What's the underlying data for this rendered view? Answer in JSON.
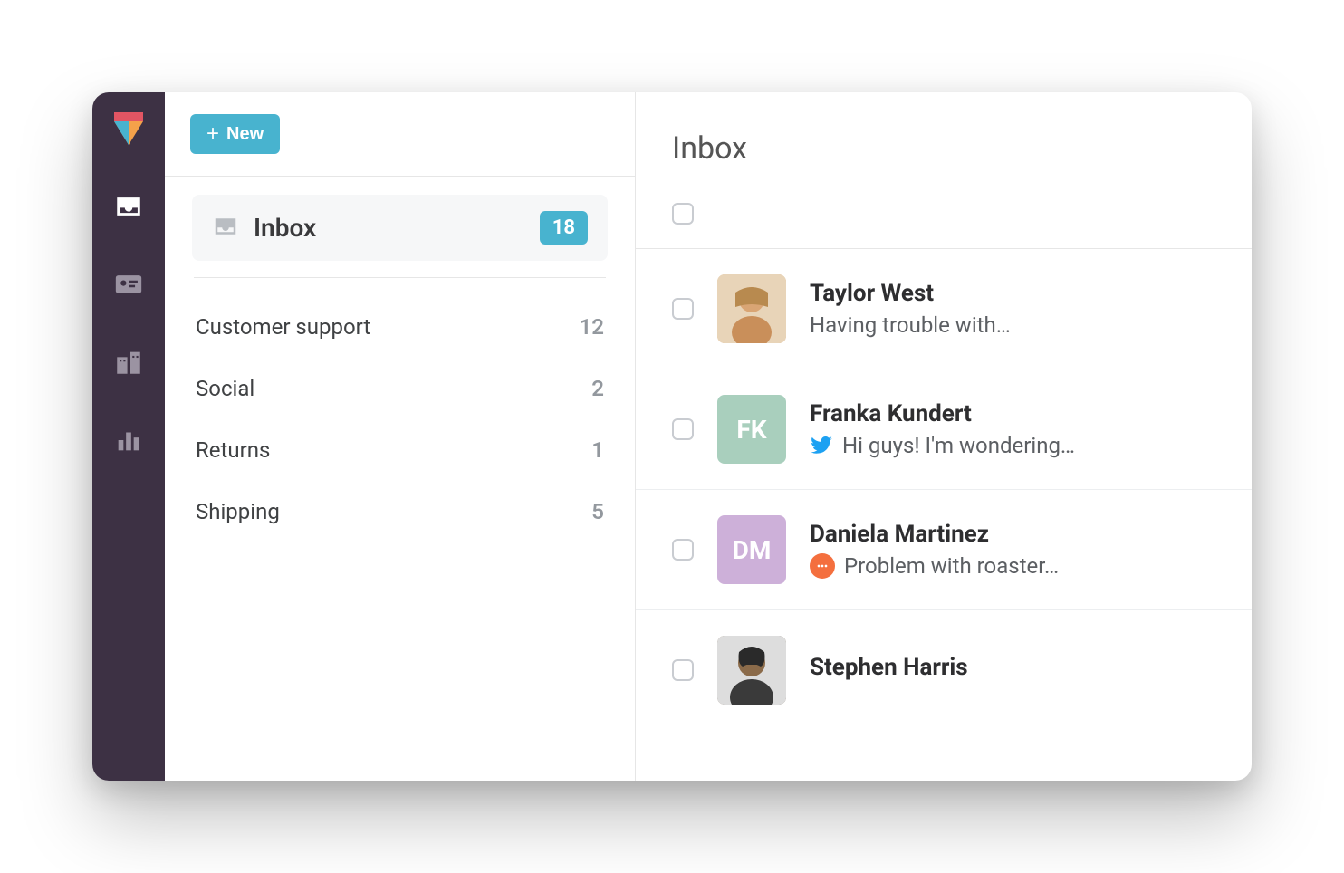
{
  "header": {
    "new_button": "New"
  },
  "sidebar": {
    "primary_folder": {
      "label": "Inbox",
      "count": "18"
    },
    "folders": [
      {
        "label": "Customer support",
        "count": "12"
      },
      {
        "label": "Social",
        "count": "2"
      },
      {
        "label": "Returns",
        "count": "1"
      },
      {
        "label": "Shipping",
        "count": "5"
      }
    ]
  },
  "main": {
    "title": "Inbox",
    "conversations": [
      {
        "name": "Taylor West",
        "preview": "Having trouble with…",
        "avatar_type": "photo",
        "avatar_bg": "#e8c9a0",
        "initials": "",
        "channel": "none"
      },
      {
        "name": "Franka Kundert",
        "preview": "Hi guys! I'm wondering…",
        "avatar_type": "initials",
        "avatar_bg": "#a9cfbd",
        "initials": "FK",
        "channel": "twitter"
      },
      {
        "name": "Daniela Martinez",
        "preview": "Problem with roaster…",
        "avatar_type": "initials",
        "avatar_bg": "#cdb0d9",
        "initials": "DM",
        "channel": "chat"
      },
      {
        "name": "Stephen Harris",
        "preview": "",
        "avatar_type": "photo",
        "avatar_bg": "#8b7355",
        "initials": "",
        "channel": "none"
      }
    ]
  }
}
